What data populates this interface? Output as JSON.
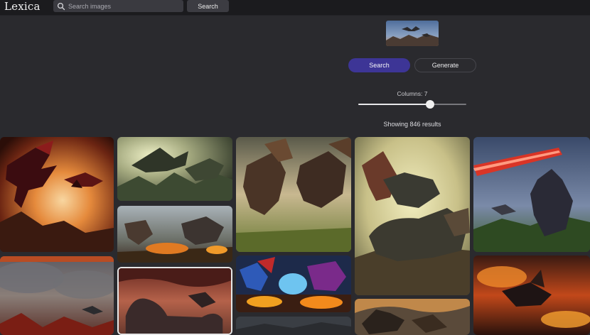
{
  "app": {
    "logo": "Lexica"
  },
  "search": {
    "placeholder": "Search images",
    "button_label": "Search"
  },
  "actions": {
    "search_label": "Search",
    "generate_label": "Generate"
  },
  "columns": {
    "label": "Columns: 7",
    "value": 7,
    "min": 1,
    "max": 10
  },
  "results": {
    "text": "Showing 846 results"
  },
  "colors": {
    "accent": "#3d3596",
    "background": "#2a2a2e",
    "topbar": "#1b1b1e"
  },
  "gallery": [
    {
      "subject": "red winged dragon at sunset"
    },
    {
      "subject": "green dragons in misty mountains"
    },
    {
      "subject": "dragons battling over fire"
    },
    {
      "subject": "brown dragons on grassland"
    },
    {
      "subject": "warrior riding dinosaur"
    },
    {
      "subject": "dragon with red laser beam"
    },
    {
      "subject": "dragon in stormy clouds"
    },
    {
      "subject": "long necked dragon red sky"
    },
    {
      "subject": "colorful cartoon dragons with fire"
    },
    {
      "subject": "dragon skeleton"
    },
    {
      "subject": "dragon flying over lava"
    },
    {
      "subject": "dark landscape"
    }
  ]
}
